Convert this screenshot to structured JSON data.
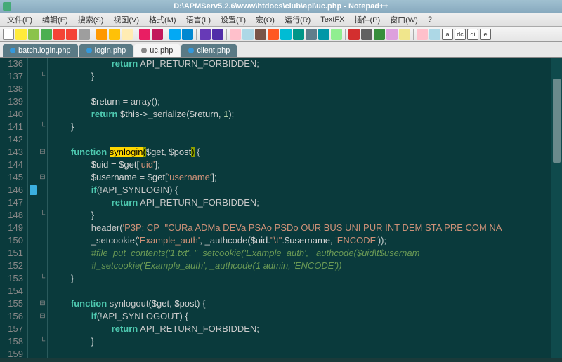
{
  "title": "D:\\APMServ5.2.6\\www\\htdocs\\club\\api\\uc.php - Notepad++",
  "menu": [
    {
      "label": "文件(F)"
    },
    {
      "label": "编辑(E)"
    },
    {
      "label": "搜索(S)"
    },
    {
      "label": "视图(V)"
    },
    {
      "label": "格式(M)"
    },
    {
      "label": "语言(L)"
    },
    {
      "label": "设置(T)"
    },
    {
      "label": "宏(O)"
    },
    {
      "label": "运行(R)"
    },
    {
      "label": "TextFX"
    },
    {
      "label": "插件(P)"
    },
    {
      "label": "窗口(W)"
    },
    {
      "label": "?"
    }
  ],
  "toolbar_letters": {
    "a": "a",
    "dc": "dc",
    "di": "di",
    "e": "e"
  },
  "tabs": [
    {
      "label": "batch.login.php",
      "active": false
    },
    {
      "label": "login.php",
      "active": false
    },
    {
      "label": "uc.php",
      "active": true
    },
    {
      "label": "client.php",
      "active": false
    }
  ],
  "lines": {
    "start": 136,
    "end": 159,
    "bookmarks": {
      "146": true
    },
    "fold_open": [
      143,
      145,
      155,
      156
    ],
    "fold_close": [
      137,
      141,
      148,
      153,
      158
    ]
  },
  "code": {
    "l136": {
      "indent": "\t\t\t",
      "kw": "return",
      "sp": " ",
      "c": "API_RETURN_FORBIDDEN",
      "sc": ";"
    },
    "l137": {
      "indent": "\t\t",
      "br": "}"
    },
    "l138": "",
    "l139": {
      "indent": "\t\t",
      "v": "$return",
      "eq": " = ",
      "fn": "array",
      "p": "();"
    },
    "l140": {
      "indent": "\t\t",
      "kw": "return",
      "sp": " ",
      "v": "$this",
      "arrow": "->",
      "fn": "_serialize",
      "op": "(",
      "v2": "$return",
      "comma": ", ",
      "n": "1",
      "cp": ");"
    },
    "l141": {
      "indent": "\t",
      "br": "}"
    },
    "l142": "",
    "l143": {
      "indent": "\t",
      "kw": "function",
      "sp": " ",
      "name": "synlogin",
      "op": "(",
      "v1": "$get",
      "comma": ", ",
      "v2": "$post",
      "cp": ")",
      "sp2": " {",
      "hl": true
    },
    "l144": {
      "indent": "\t\t",
      "v": "$uid",
      "eq": " = ",
      "v2": "$get",
      "br": "[",
      "s": "'uid'",
      "br2": "];"
    },
    "l145": {
      "indent": "\t\t",
      "v": "$username",
      "eq": " = ",
      "v2": "$get",
      "br": "[",
      "s": "'username'",
      "br2": "];"
    },
    "l146": {
      "indent": "\t\t",
      "kw": "if",
      "op": "(!",
      "c": "API_SYNLOGIN",
      "cp": ") {"
    },
    "l147": {
      "indent": "\t\t\t",
      "kw": "return",
      "sp": " ",
      "c": "API_RETURN_FORBIDDEN",
      "sc": ";"
    },
    "l148": {
      "indent": "\t\t",
      "br": "}"
    },
    "l149": {
      "indent": "\t\t",
      "fn": "header",
      "op": "(",
      "s": "'P3P: CP=\"CURa ADMa DEVa PSAo PSDo OUR BUS UNI PUR INT DEM STA PRE COM NA"
    },
    "l150": {
      "indent": "\t\t",
      "fn": "_setcookie",
      "op": "(",
      "s1": "'Example_auth'",
      "comma": ", ",
      "fn2": "_authcode",
      "op2": "(",
      "v": "$uid",
      "dot": ".",
      "s2": "\"\\t\"",
      "dot2": ".",
      "v2": "$username",
      "comma2": ", ",
      "s3": "'ENCODE'",
      "cp": "));"
    },
    "l151": {
      "indent": "\t\t",
      "cmt": "#file_put_contents('1.txt', \"_setcookie('Example_auth', _authcode($uid\\t$usernam"
    },
    "l152": {
      "indent": "\t\t",
      "cmt": "#_setcookie('Example_auth', _authcode(1 admin, 'ENCODE'))"
    },
    "l153": {
      "indent": "\t",
      "br": "}"
    },
    "l154": "",
    "l155": {
      "indent": "\t",
      "kw": "function",
      "sp": " ",
      "name": "synlogout",
      "op": "(",
      "v1": "$get",
      "comma": ", ",
      "v2": "$post",
      "cp": ") {"
    },
    "l156": {
      "indent": "\t\t",
      "kw": "if",
      "op": "(!",
      "c": "API_SYNLOGOUT",
      "cp": ") {"
    },
    "l157": {
      "indent": "\t\t\t",
      "kw": "return",
      "sp": " ",
      "c": "API_RETURN_FORBIDDEN",
      "sc": ";"
    },
    "l158": {
      "indent": "\t\t",
      "br": "}"
    },
    "l159": ""
  }
}
